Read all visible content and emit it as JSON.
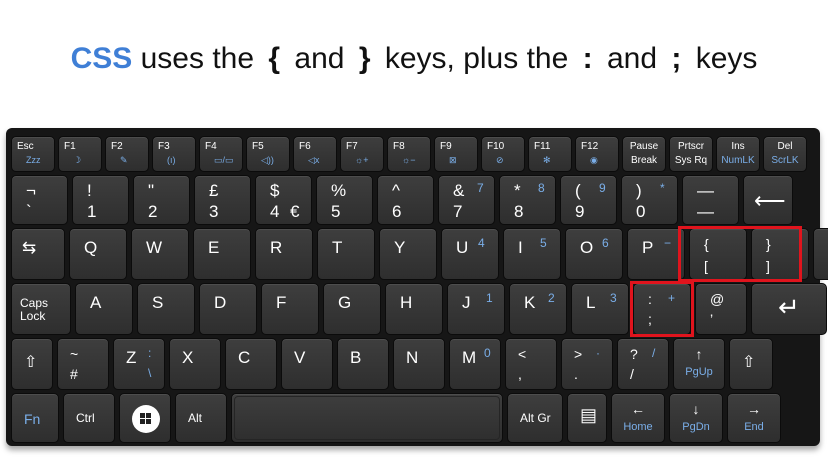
{
  "caption": {
    "css": "CSS",
    "part1": "uses the",
    "open_brace": "{",
    "and1": "and",
    "close_brace": "}",
    "part2": "keys, plus the",
    "colon": ":",
    "and2": "and",
    "semicolon": ";",
    "keys": "keys"
  },
  "colors": {
    "css_text": "#3f7fd6",
    "highlight": "#e0141d",
    "key_face": "#363636",
    "fn_blue": "#7aaee8"
  },
  "keyboard": {
    "function_row": [
      {
        "name": "esc",
        "main": "Esc",
        "sub": "Zzz"
      },
      {
        "name": "f1",
        "main": "F1",
        "sub": "☽"
      },
      {
        "name": "f2",
        "main": "F2",
        "sub": "✎"
      },
      {
        "name": "f3",
        "main": "F3",
        "sub": "(ı)"
      },
      {
        "name": "f4",
        "main": "F4",
        "sub": "▭/▭"
      },
      {
        "name": "f5",
        "main": "F5",
        "sub": "◁))"
      },
      {
        "name": "f6",
        "main": "F6",
        "sub": "◁x"
      },
      {
        "name": "f7",
        "main": "F7",
        "sub": "☼+"
      },
      {
        "name": "f8",
        "main": "F8",
        "sub": "☼−"
      },
      {
        "name": "f9",
        "main": "F9",
        "sub": "⊠"
      },
      {
        "name": "f10",
        "main": "F10",
        "sub": "⊘"
      },
      {
        "name": "f11",
        "main": "F11",
        "sub": "✻"
      },
      {
        "name": "f12",
        "main": "F12",
        "sub": "◉"
      },
      {
        "name": "pause",
        "main": "Pause",
        "sub": "Break"
      },
      {
        "name": "prtscr",
        "main": "Prtscr",
        "sub": "Sys Rq"
      },
      {
        "name": "ins",
        "main": "Ins",
        "sub": "NumLK"
      },
      {
        "name": "del",
        "main": "Del",
        "sub": "ScrLK"
      }
    ],
    "number_row": [
      {
        "name": "backtick",
        "top": "¬",
        "bottom": "`"
      },
      {
        "name": "1",
        "top": "!",
        "bottom": "1"
      },
      {
        "name": "2",
        "top": "\"",
        "bottom": "2"
      },
      {
        "name": "3",
        "top": "£",
        "bottom": "3"
      },
      {
        "name": "4",
        "top": "$",
        "bottom": "4",
        "extra": "€"
      },
      {
        "name": "5",
        "top": "%",
        "bottom": "5"
      },
      {
        "name": "6",
        "top": "^",
        "bottom": "6"
      },
      {
        "name": "7",
        "top": "&",
        "bottom": "7",
        "fn": "7"
      },
      {
        "name": "8",
        "top": "*",
        "bottom": "8",
        "fn": "8"
      },
      {
        "name": "9",
        "top": "(",
        "bottom": "9",
        "fn": "9"
      },
      {
        "name": "0",
        "top": ")",
        "bottom": "0",
        "fn": "*"
      },
      {
        "name": "minus",
        "top": "—",
        "bottom": "—"
      },
      {
        "name": "backspace",
        "top": "⟵",
        "bottom": ""
      }
    ],
    "tab_row": [
      {
        "name": "tab",
        "main": "⇆"
      },
      {
        "name": "q",
        "main": "Q"
      },
      {
        "name": "w",
        "main": "W"
      },
      {
        "name": "e",
        "main": "E"
      },
      {
        "name": "r",
        "main": "R"
      },
      {
        "name": "t",
        "main": "T"
      },
      {
        "name": "y",
        "main": "Y"
      },
      {
        "name": "u",
        "main": "U",
        "fn": "4"
      },
      {
        "name": "i",
        "main": "I",
        "fn": "5"
      },
      {
        "name": "o",
        "main": "O",
        "fn": "6"
      },
      {
        "name": "p",
        "main": "P",
        "fn": "−"
      },
      {
        "name": "lbracket",
        "top": "{",
        "bottom": "["
      },
      {
        "name": "rbracket",
        "top": "}",
        "bottom": "]"
      },
      {
        "name": "equals",
        "top": "+",
        "bottom": "="
      }
    ],
    "home_row": [
      {
        "name": "capslock",
        "top": "Caps",
        "bottom": "Lock"
      },
      {
        "name": "a",
        "main": "A"
      },
      {
        "name": "s",
        "main": "S"
      },
      {
        "name": "d",
        "main": "D"
      },
      {
        "name": "f",
        "main": "F"
      },
      {
        "name": "g",
        "main": "G"
      },
      {
        "name": "h",
        "main": "H"
      },
      {
        "name": "j",
        "main": "J",
        "fn": "1"
      },
      {
        "name": "k",
        "main": "K",
        "fn": "2"
      },
      {
        "name": "l",
        "main": "L",
        "fn": "3"
      },
      {
        "name": "semicolon",
        "top": ":",
        "bottom": ";",
        "fn": "+"
      },
      {
        "name": "quote",
        "top": "@",
        "bottom": "’"
      },
      {
        "name": "enter",
        "main": "↵"
      }
    ],
    "shift_row": [
      {
        "name": "lshift",
        "main": "⇧"
      },
      {
        "name": "hash",
        "top": "~",
        "bottom": "#"
      },
      {
        "name": "z",
        "main": "Z",
        "fn": ":",
        "fn2": "\\"
      },
      {
        "name": "x",
        "main": "X"
      },
      {
        "name": "c",
        "main": "C"
      },
      {
        "name": "v",
        "main": "V"
      },
      {
        "name": "b",
        "main": "B"
      },
      {
        "name": "n",
        "main": "N"
      },
      {
        "name": "m",
        "main": "M",
        "fn": "0"
      },
      {
        "name": "comma",
        "top": "<",
        "bottom": ","
      },
      {
        "name": "period",
        "top": ">",
        "bottom": ".",
        "fn": "·"
      },
      {
        "name": "slash",
        "top": "?",
        "bottom": "/",
        "fn": "/"
      },
      {
        "name": "pgup",
        "top": "↑",
        "bottom": "PgUp"
      },
      {
        "name": "rshift",
        "main": "⇧"
      }
    ],
    "bottom_row": [
      {
        "name": "fn",
        "main": "Fn"
      },
      {
        "name": "ctrl",
        "main": "Ctrl"
      },
      {
        "name": "win",
        "main": ""
      },
      {
        "name": "alt",
        "main": "Alt"
      },
      {
        "name": "space",
        "main": ""
      },
      {
        "name": "altgr",
        "main": "Alt Gr"
      },
      {
        "name": "menu",
        "main": "▤"
      },
      {
        "name": "home",
        "top": "←",
        "bottom": "Home"
      },
      {
        "name": "pgdn",
        "top": "↓",
        "bottom": "PgDn"
      },
      {
        "name": "end",
        "top": "→",
        "bottom": "End"
      }
    ]
  }
}
